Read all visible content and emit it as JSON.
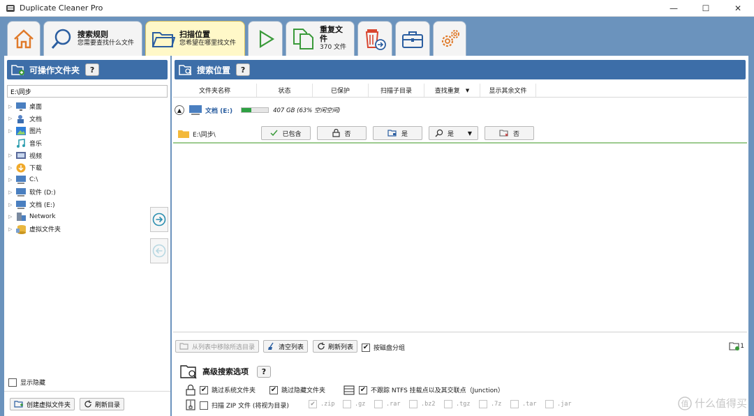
{
  "window": {
    "title": "Duplicate Cleaner Pro"
  },
  "tabs": {
    "search_rules": {
      "label": "搜索规则",
      "sub": "您需要查找什么文件"
    },
    "scan_location": {
      "label": "扫描位置",
      "sub": "您希望在哪里找文件"
    },
    "duplicates": {
      "label": "重复文件",
      "sub": "370 文件"
    }
  },
  "left": {
    "header": "可操作文件夹",
    "help": "?",
    "path_value": "E:\\同步",
    "tree": [
      {
        "label": "桌面",
        "icon": "desktop-icon"
      },
      {
        "label": "文档",
        "icon": "documents-icon"
      },
      {
        "label": "图片",
        "icon": "pictures-icon"
      },
      {
        "label": "音乐",
        "icon": "music-icon"
      },
      {
        "label": "视频",
        "icon": "video-icon"
      },
      {
        "label": "下载",
        "icon": "download-icon"
      },
      {
        "label": "C:\\",
        "icon": "drive-icon"
      },
      {
        "label": "软件 (D:)",
        "icon": "drive-icon"
      },
      {
        "label": "文档 (E:)",
        "icon": "drive-icon"
      },
      {
        "label": "Network",
        "icon": "network-icon"
      },
      {
        "label": "虚拟文件夹",
        "icon": "virtual-folder-icon"
      }
    ],
    "show_hidden": "显示隐藏",
    "create_virtual": "创建虚拟文件夹",
    "refresh_dir": "刷新目录"
  },
  "right": {
    "header": "搜索位置",
    "help": "?",
    "columns": [
      "文件夹名称",
      "状态",
      "已保护",
      "扫描子目录",
      "查找重复",
      "显示其余文件"
    ],
    "drive": {
      "name": "文档 (E:)",
      "space_text": "407 GB (63% 空闲空间)",
      "free_fraction": 0.63
    },
    "folder": {
      "name": "E:\\同步\\",
      "status": "已包含",
      "protected": "否",
      "subdirs": "是",
      "find_dup": "是",
      "show_rest": "否"
    },
    "remove_selected": "从列表中移除所选目录",
    "clear_list": "清空列表",
    "refresh_list": "刷新列表",
    "group_by_disk": "按磁盘分组",
    "folder_count": "1",
    "advanced_title": "高级搜索选项",
    "skip_system": "跳过系统文件夹",
    "skip_hidden": "跳过隐藏文件夹",
    "no_ntfs": "不跟踪 NTFS 挂载点以及其交联点（Junction）",
    "scan_zip": "扫描 ZIP 文件 (将视为目录)",
    "extensions": [
      ".zip",
      ".gz",
      ".rar",
      ".bz2",
      ".tgz",
      ".7z",
      ".tar",
      ".jar"
    ]
  },
  "watermark": "什么值得买"
}
